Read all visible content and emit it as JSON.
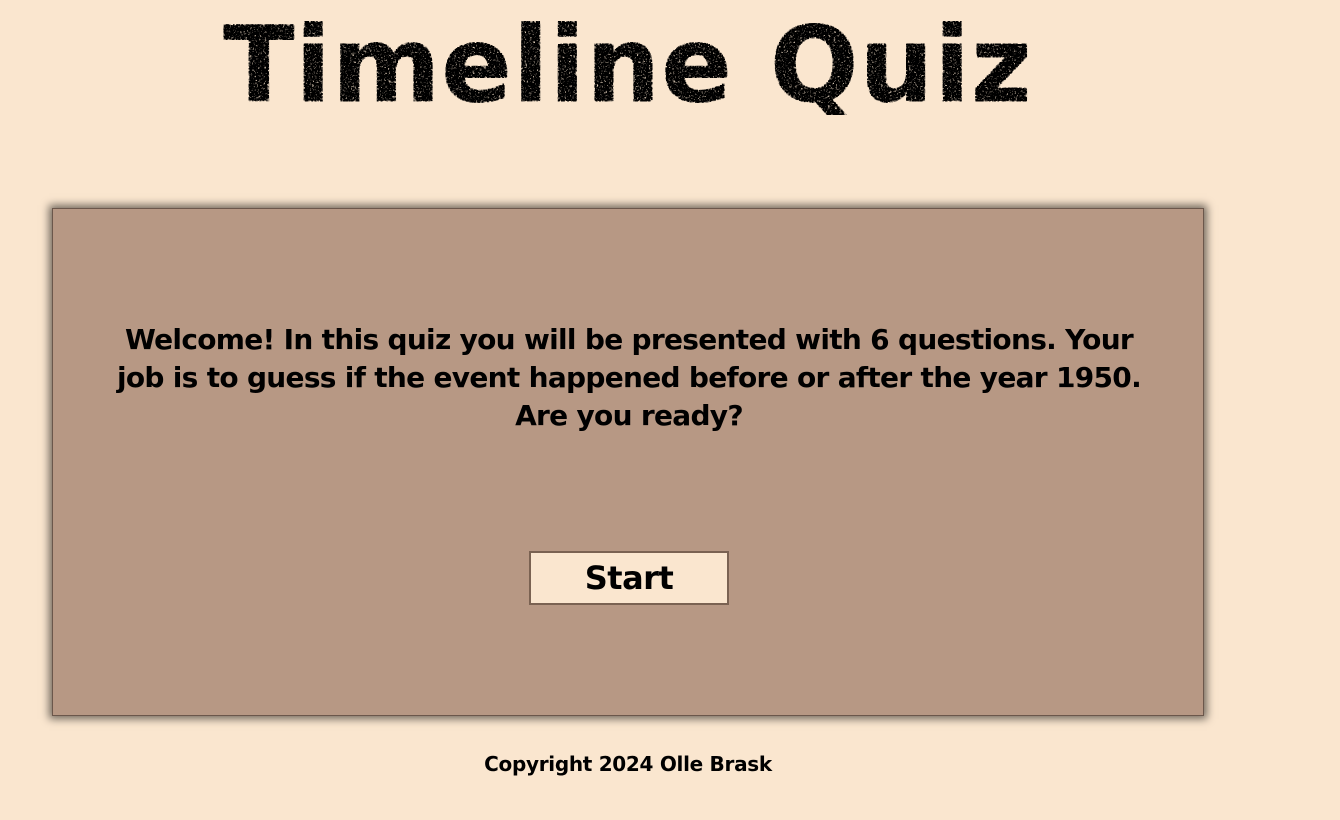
{
  "title": "Timeline Quiz",
  "welcome": {
    "text": "Welcome! In this quiz you will be presented with 6 questions. Your job is to guess if the event happened before or after the year 1950. Are you ready?"
  },
  "start_button": {
    "label": "Start"
  },
  "footer": {
    "copyright": "Copyright 2024 Olle Brask"
  },
  "colors": {
    "page_background": "#fae6cf",
    "card_background": "#b79884",
    "button_background": "#fae6cf",
    "button_border": "#7a6252",
    "text": "#000000"
  }
}
